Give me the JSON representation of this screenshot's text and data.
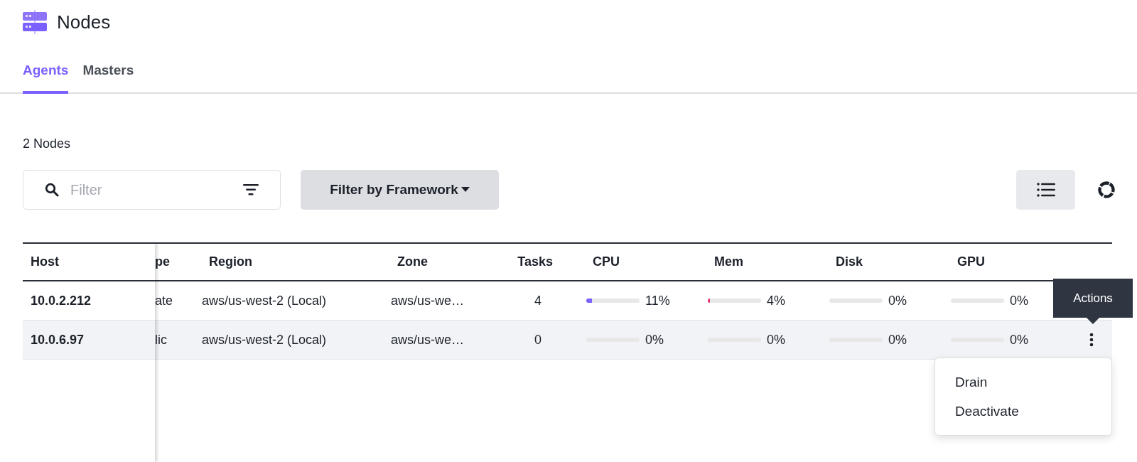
{
  "page": {
    "title": "Nodes"
  },
  "tabs": [
    {
      "label": "Agents",
      "selected": true
    },
    {
      "label": "Masters",
      "selected": false
    }
  ],
  "summary": "2 Nodes",
  "filter": {
    "placeholder": "Filter"
  },
  "framework_button": {
    "label": "Filter by Framework"
  },
  "table": {
    "columns": [
      {
        "label": "Host",
        "kind": "host"
      },
      {
        "label": "pe",
        "kind": "clipped"
      },
      {
        "label": "Region",
        "kind": "text"
      },
      {
        "label": "Zone",
        "kind": "text"
      },
      {
        "label": "Tasks",
        "kind": "number"
      },
      {
        "label": "CPU",
        "kind": "meter"
      },
      {
        "label": "Mem",
        "kind": "meter"
      },
      {
        "label": "Disk",
        "kind": "meter"
      },
      {
        "label": "GPU",
        "kind": "meter"
      }
    ],
    "rows": [
      {
        "highlighted": false,
        "cells": [
          {
            "text": "10.0.2.212"
          },
          {
            "text": "ate"
          },
          {
            "text": "aws/us-west-2 (Local)"
          },
          {
            "text": "aws/us-we…"
          },
          {
            "text": "4"
          },
          {
            "level": 0.11,
            "reading": "11%",
            "color": "#7b61ff"
          },
          {
            "level": 0.04,
            "reading": "4%",
            "color": "#e8336e"
          },
          {
            "reading": "0%"
          },
          {
            "reading": "0%"
          }
        ]
      },
      {
        "highlighted": true,
        "cells": [
          {
            "text": "10.0.6.97"
          },
          {
            "text": "lic"
          },
          {
            "text": "aws/us-west-2 (Local)"
          },
          {
            "text": "aws/us-we…"
          },
          {
            "text": "0"
          },
          {
            "reading": "0%"
          },
          {
            "reading": "0%"
          },
          {
            "reading": "0%"
          },
          {
            "reading": "0%"
          }
        ]
      }
    ]
  },
  "tooltip": {
    "text": "Actions"
  },
  "menu": {
    "items": [
      {
        "label": "Drain"
      },
      {
        "label": "Deactivate"
      }
    ]
  }
}
